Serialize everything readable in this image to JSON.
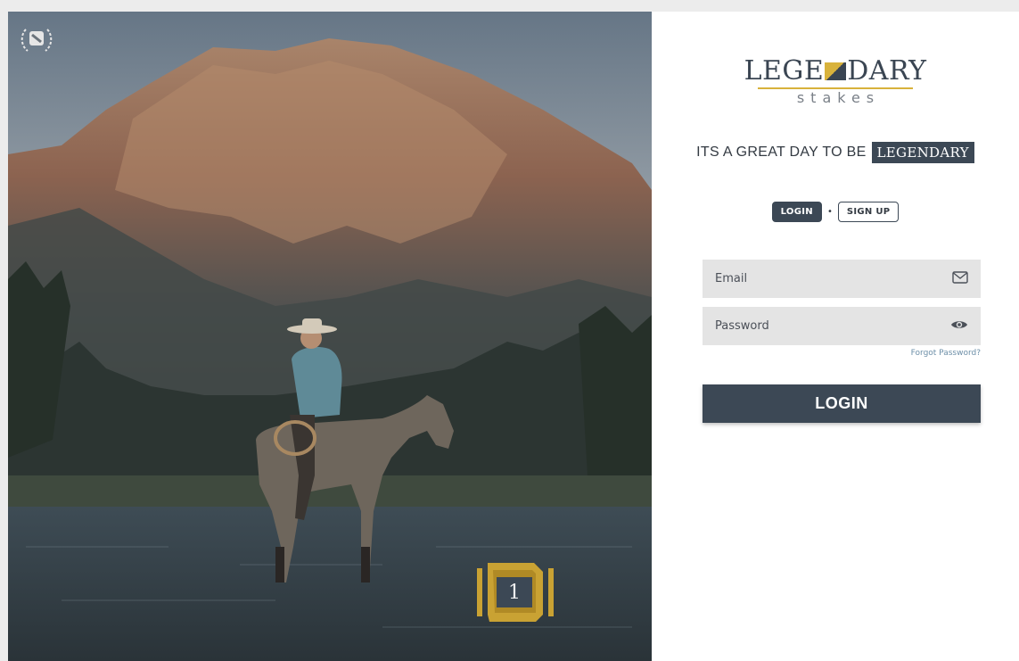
{
  "hero": {
    "laurel_icon": "laurel-logo-icon",
    "badge": {
      "number": "1",
      "icon": "gold-frame-icon",
      "accent": "#c9a233"
    }
  },
  "brand": {
    "word_left": "LEGE",
    "word_right": "DARY",
    "sub": "stakes",
    "accent": "#d8b23c",
    "primary": "#3c4855"
  },
  "tagline": {
    "text": "ITS A GREAT DAY TO BE",
    "highlight": "LEGENDARY"
  },
  "mode_tabs": {
    "login": "LOGIN",
    "signup": "SIGN UP",
    "separator": "•"
  },
  "form": {
    "email_placeholder": "Email",
    "email_icon": "envelope-icon",
    "password_placeholder": "Password",
    "password_icon": "eye-icon",
    "forgot": "Forgot Password?",
    "submit": "LOGIN"
  }
}
